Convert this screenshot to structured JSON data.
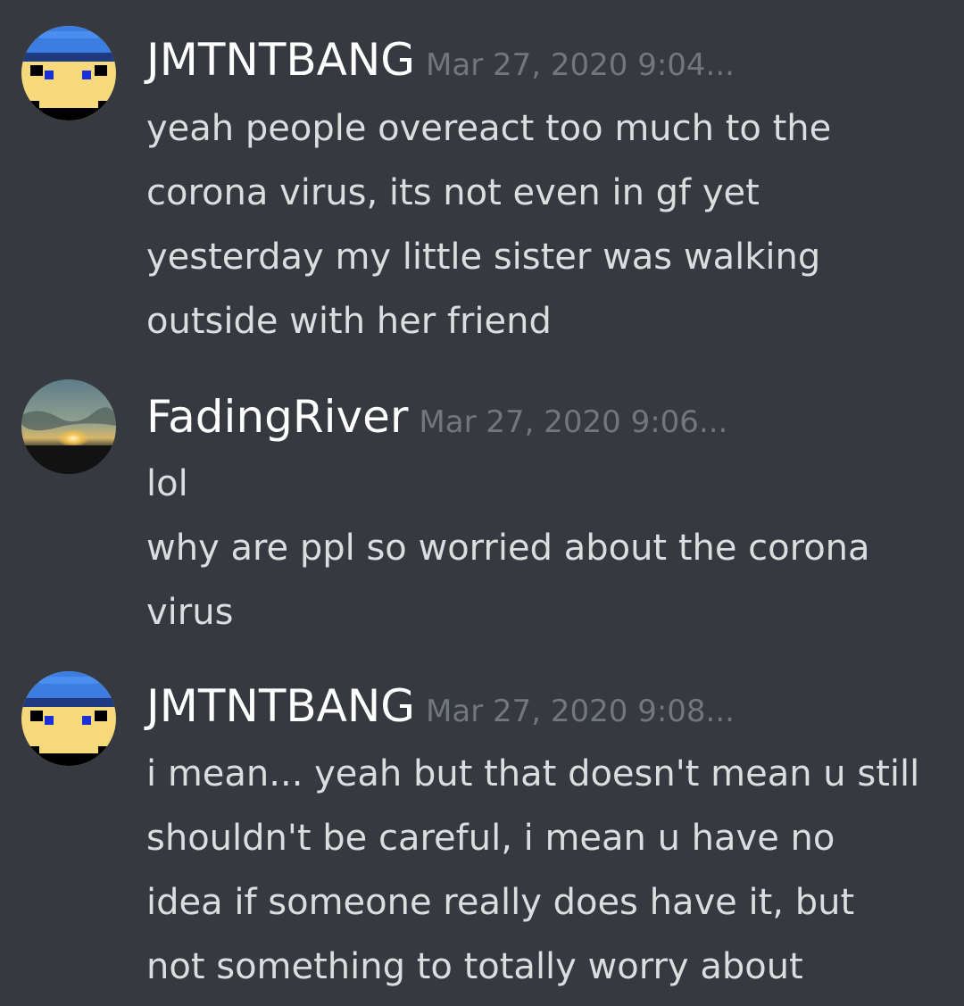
{
  "colors": {
    "background": "#36393f",
    "username": "#ffffff",
    "timestamp": "#72767d",
    "message_text": "#dcddde"
  },
  "messages": [
    {
      "username": "JMTNTBANG",
      "timestamp": "Mar 27, 2020 9:04...",
      "avatar": "pixel-face-blue-cap-avatar",
      "lines": [
        "yeah people overeact too much to the",
        "corona virus, its not even in gf yet",
        "yesterday my little sister was walking",
        "outside with her friend"
      ]
    },
    {
      "username": "FadingRiver",
      "timestamp": "Mar 27, 2020 9:06...",
      "avatar": "sunset-landscape-avatar",
      "lines": [
        "lol",
        "why are ppl so worried about the corona",
        "virus"
      ]
    },
    {
      "username": "JMTNTBANG",
      "timestamp": "Mar 27, 2020 9:08...",
      "avatar": "pixel-face-blue-cap-avatar",
      "lines": [
        "i mean... yeah but that doesn't mean u still",
        "shouldn't be careful, i mean u have no",
        "idea if someone really does have it, but",
        "not something to totally worry about"
      ]
    }
  ]
}
